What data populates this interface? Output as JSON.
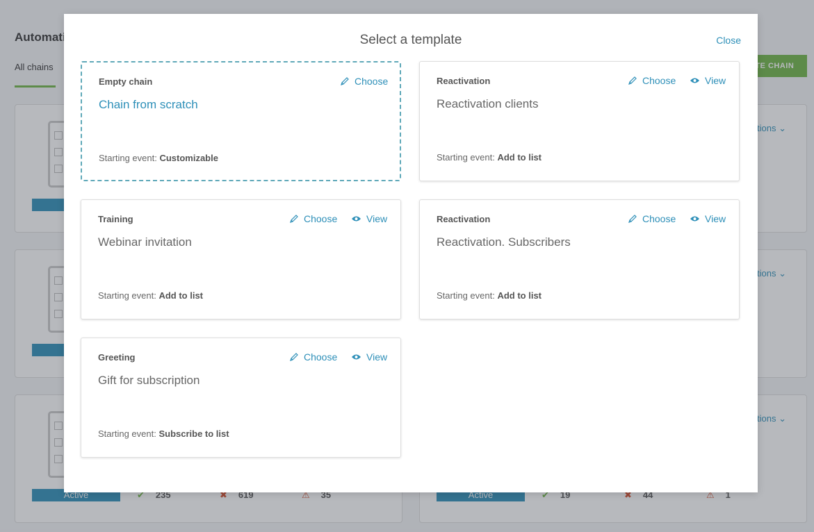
{
  "background": {
    "page_title": "Automati",
    "tab_all_chains": "All chains",
    "create_button": "ATE CHAIN",
    "actions_label": "tions",
    "rows": [
      {
        "status": "Active",
        "ok": "235",
        "err": "619",
        "warn": "35"
      },
      {
        "status": "Active",
        "ok": "19",
        "err": "44",
        "warn": "1"
      }
    ]
  },
  "modal": {
    "title": "Select a template",
    "close_label": "Close",
    "choose_label": "Choose",
    "view_label": "View",
    "event_prefix": "Starting event:",
    "templates": [
      {
        "category": "Empty chain",
        "name": "Chain from scratch",
        "event": "Customizable"
      },
      {
        "category": "Reactivation",
        "name": "Reactivation clients",
        "event": "Add to list"
      },
      {
        "category": "Training",
        "name": "Webinar invitation",
        "event": "Add to list"
      },
      {
        "category": "Reactivation",
        "name": "Reactivation. Subscribers",
        "event": "Add to list"
      },
      {
        "category": "Greeting",
        "name": "Gift for subscription",
        "event": "Subscribe to list"
      }
    ]
  },
  "colors": {
    "accent": "#2d8fb8",
    "success": "#6fb544",
    "error": "#d24b2b"
  }
}
